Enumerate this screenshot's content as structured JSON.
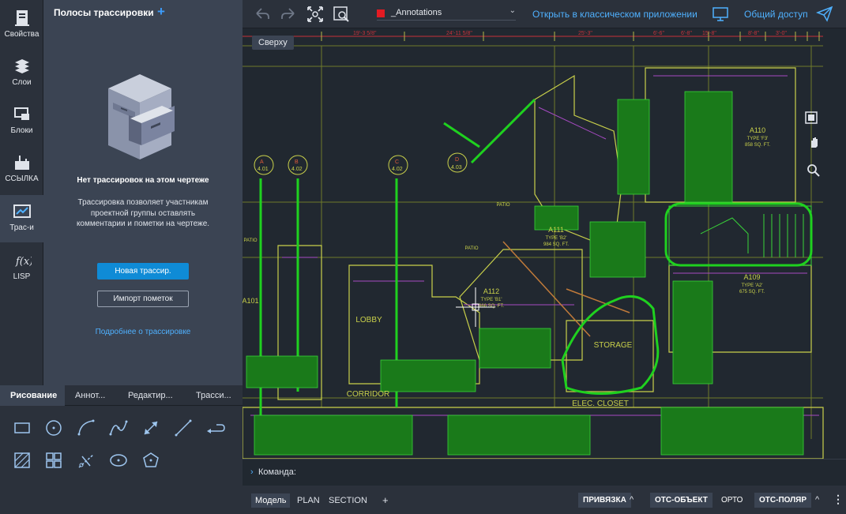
{
  "rail": {
    "items": [
      {
        "label": "Свойства",
        "icon": "properties-icon"
      },
      {
        "label": "Слои",
        "icon": "layers-icon"
      },
      {
        "label": "Блоки",
        "icon": "blocks-icon"
      },
      {
        "label": "ССЫЛКА",
        "icon": "xref-icon"
      },
      {
        "label": "Трас-и",
        "icon": "trace-icon"
      },
      {
        "label": "LISP",
        "icon": "lisp-icon"
      }
    ],
    "active_index": 4
  },
  "panel": {
    "title": "Полосы трассировки",
    "add_label": "+",
    "empty_title": "Нет трассировок на этом чертеже",
    "empty_description": "Трассировка позволяет участникам проектной группы оставлять комментарии и пометки на чертеже.",
    "new_button": "Новая трассир.",
    "import_button": "Импорт пометок",
    "learn_more": "Подробнее о трассировке"
  },
  "palette": {
    "tabs": [
      "Рисование",
      "Аннот...",
      "Редактир...",
      "Трасси..."
    ],
    "active_tab": 0,
    "tools": [
      "rectangle-icon",
      "circle-icon",
      "arc-icon",
      "spline-icon",
      "double-arrow-icon",
      "line-icon",
      "polyline-arrow-icon",
      "hatch-icon",
      "array-icon",
      "trim-icon",
      "ellipse-icon",
      "polygon-icon"
    ]
  },
  "toolbar": {
    "layer_name": "_Annotations",
    "layer_color": "#e31b23",
    "open_classic": "Открыть в классическом приложении",
    "share": "Общий доступ"
  },
  "drawing": {
    "view_label": "Сверху",
    "room_labels": [
      "A111",
      "A110",
      "A112",
      "A109",
      "A101",
      "LOBBY",
      "CORRIDOR",
      "STORAGE",
      "ELEC. CLOSET",
      "PATIO"
    ],
    "grid_bubbles": [
      "A 4.01",
      "B 4.02",
      "C 4.02",
      "D 4.03"
    ]
  },
  "command": {
    "prompt": "Команда:"
  },
  "status": {
    "layout_tabs": [
      "Модель",
      "PLAN",
      "SECTION"
    ],
    "active_tab": 0,
    "add_tab": "+",
    "toggles": [
      {
        "label": "ПРИВЯЗКА",
        "on": true
      },
      {
        "label": "ОТС-ОБЪЕКТ",
        "on": true
      },
      {
        "label": "ОРТО",
        "on": false
      },
      {
        "label": "ОТС-ПОЛЯР",
        "on": true
      }
    ]
  }
}
